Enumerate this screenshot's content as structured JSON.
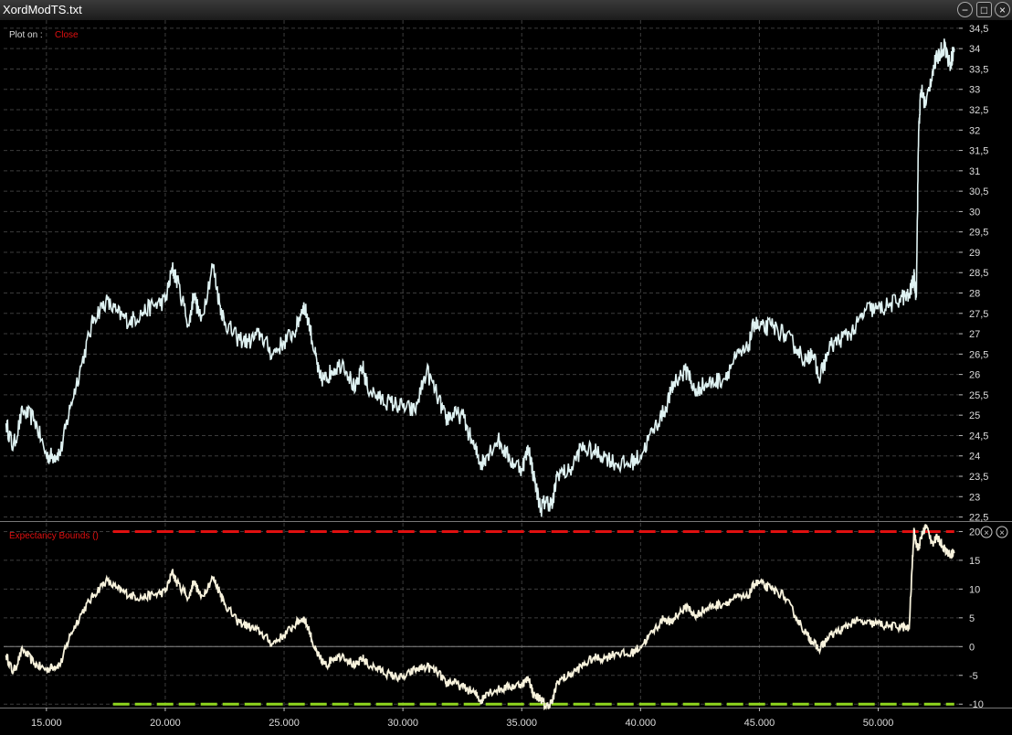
{
  "window": {
    "title": "XordModTS.txt",
    "min_icon": "minimize-icon",
    "max_icon": "maximize-icon",
    "close_icon": "close-icon"
  },
  "colors": {
    "background": "#000000",
    "grid": "#3c3c3c",
    "price_line": "#dff2f2",
    "bounds_line": "#f7f2dc",
    "upper_bound": "#e01010",
    "lower_bound": "#8fd61e",
    "label_red": "#e01010",
    "text": "#dddddd"
  },
  "chart_data": [
    {
      "type": "line",
      "plot_label": "Plot on : ",
      "series_label": "Close",
      "xlim": [
        13200,
        53400
      ],
      "ylim": [
        22.4,
        34.7
      ],
      "x_ticks": [
        15000,
        20000,
        25000,
        30000,
        35000,
        40000,
        45000,
        50000
      ],
      "x_tick_labels": [
        "15.000",
        "20.000",
        "25.000",
        "30.000",
        "35.000",
        "40.000",
        "45.000",
        "50.000"
      ],
      "y_ticks": [
        22.5,
        23,
        23.5,
        24,
        24.5,
        25,
        25.5,
        26,
        26.5,
        27,
        27.5,
        28,
        28.5,
        29,
        29.5,
        30,
        30.5,
        31,
        31.5,
        32,
        32.5,
        33,
        33.5,
        34,
        34.5
      ],
      "y_tick_labels": [
        "22,5",
        "23",
        "23,5",
        "24",
        "24,5",
        "25",
        "25,5",
        "26",
        "26,5",
        "27",
        "27,5",
        "28",
        "28,5",
        "29",
        "29,5",
        "30",
        "30,5",
        "31",
        "31,5",
        "32",
        "32,5",
        "33",
        "33,5",
        "34",
        "34,5"
      ],
      "grid": true,
      "x": [
        13300,
        13600,
        14000,
        14500,
        15000,
        15300,
        15600,
        16000,
        16500,
        17000,
        17500,
        18000,
        18500,
        19000,
        19500,
        20000,
        20300,
        20500,
        21000,
        21200,
        21500,
        22000,
        22300,
        22500,
        23000,
        23500,
        24000,
        24500,
        25000,
        25500,
        25800,
        26000,
        26300,
        26500,
        26800,
        27000,
        27500,
        28000,
        28300,
        28500,
        29000,
        29500,
        30000,
        30500,
        31000,
        31500,
        31800,
        32000,
        32500,
        33000,
        33300,
        33500,
        34000,
        34500,
        35000,
        35300,
        35500,
        35800,
        36000,
        36300,
        36500,
        37000,
        37500,
        38000,
        38500,
        39000,
        39500,
        40000,
        40500,
        41000,
        41300,
        41500,
        42000,
        42300,
        42500,
        43000,
        43500,
        44000,
        44500,
        44800,
        45000,
        45500,
        46000,
        46500,
        47000,
        47200,
        47500,
        48000,
        48500,
        49000,
        49500,
        50000,
        50500,
        51000,
        51300,
        51500,
        51600,
        51700,
        51800,
        52000,
        52300,
        52500,
        52800,
        53000,
        53200
      ],
      "values": [
        24.8,
        24.2,
        25.1,
        24.9,
        24.0,
        24.0,
        24.1,
        25.2,
        26.3,
        27.4,
        27.8,
        27.5,
        27.3,
        27.5,
        27.7,
        27.8,
        28.6,
        28.3,
        27.2,
        28.0,
        27.3,
        28.7,
        27.7,
        27.3,
        26.9,
        26.8,
        27.0,
        26.5,
        26.8,
        27.1,
        27.7,
        27.4,
        26.5,
        25.9,
        25.9,
        26.1,
        26.3,
        25.6,
        26.2,
        25.7,
        25.4,
        25.3,
        25.2,
        25.1,
        26.1,
        25.4,
        24.9,
        25.0,
        25.0,
        24.2,
        23.8,
        24.0,
        24.4,
        23.9,
        23.7,
        24.2,
        23.5,
        22.7,
        22.9,
        22.8,
        23.6,
        23.6,
        24.2,
        24.1,
        24.0,
        23.8,
        23.8,
        24.0,
        24.6,
        25.1,
        25.6,
        25.9,
        26.1,
        25.5,
        25.7,
        25.8,
        25.9,
        26.4,
        26.6,
        27.3,
        27.1,
        27.2,
        27.0,
        26.7,
        26.3,
        26.6,
        25.9,
        26.7,
        26.9,
        27.1,
        27.6,
        27.6,
        27.7,
        27.9,
        27.9,
        28.4,
        27.9,
        32.0,
        33.0,
        32.6,
        33.5,
        33.8,
        34.1,
        33.6,
        34.0
      ]
    },
    {
      "type": "line",
      "series_label": "Expectancy Bounds ()",
      "xlim": [
        13200,
        53400
      ],
      "ylim": [
        -10.6,
        21.5
      ],
      "y_ticks": [
        -10,
        -5,
        0,
        5,
        10,
        15,
        20
      ],
      "y_tick_labels": [
        "-10",
        "-5",
        "0",
        "5",
        "10",
        "15",
        "20"
      ],
      "upper_bound": {
        "value": 20,
        "x_start": 17800,
        "x_end": 53200
      },
      "lower_bound": {
        "value": -10,
        "x_start": 17800,
        "x_end": 53200
      },
      "zero_line": 0,
      "grid": true,
      "x": [
        13300,
        13600,
        14000,
        14500,
        15000,
        15300,
        15600,
        16000,
        16500,
        17000,
        17500,
        18000,
        18500,
        19000,
        19500,
        20000,
        20300,
        20500,
        21000,
        21200,
        21500,
        22000,
        22300,
        22500,
        23000,
        23500,
        24000,
        24500,
        25000,
        25500,
        25800,
        26000,
        26300,
        26500,
        26800,
        27000,
        27500,
        28000,
        28300,
        28500,
        29000,
        29500,
        30000,
        30500,
        31000,
        31500,
        31800,
        32000,
        32500,
        33000,
        33300,
        33500,
        34000,
        34500,
        35000,
        35300,
        35500,
        35800,
        36000,
        36300,
        36500,
        37000,
        37500,
        38000,
        38500,
        39000,
        39500,
        40000,
        40500,
        41000,
        41300,
        41500,
        42000,
        42300,
        42500,
        43000,
        43500,
        44000,
        44500,
        44800,
        45000,
        45500,
        46000,
        46500,
        47000,
        47200,
        47500,
        48000,
        48500,
        49000,
        49500,
        50000,
        50500,
        51000,
        51300,
        51500,
        51600,
        51700,
        51800,
        52000,
        52300,
        52500,
        52800,
        53000,
        53200
      ],
      "values": [
        -1.5,
        -4.5,
        -0.5,
        -3.0,
        -4.0,
        -3.5,
        -3.0,
        2.0,
        6.0,
        9.0,
        11.5,
        10.0,
        9.0,
        8.5,
        9.0,
        9.5,
        13.0,
        11.0,
        8.5,
        11.5,
        8.5,
        12.0,
        9.5,
        7.5,
        4.5,
        3.5,
        2.5,
        0.5,
        2.0,
        4.0,
        5.0,
        3.5,
        -0.5,
        -2.0,
        -3.5,
        -2.0,
        -1.5,
        -3.5,
        -2.0,
        -3.0,
        -4.0,
        -5.0,
        -5.5,
        -4.0,
        -3.5,
        -4.5,
        -6.5,
        -6.0,
        -7.0,
        -8.0,
        -9.5,
        -8.0,
        -7.5,
        -7.0,
        -6.5,
        -5.5,
        -8.5,
        -9.0,
        -10.5,
        -9.5,
        -6.0,
        -5.0,
        -3.5,
        -2.0,
        -2.0,
        -1.0,
        -1.5,
        0.0,
        2.5,
        5.0,
        4.0,
        5.5,
        7.0,
        5.0,
        6.0,
        7.0,
        7.5,
        8.5,
        8.5,
        11.0,
        11.0,
        10.0,
        9.0,
        5.5,
        2.0,
        1.0,
        -0.5,
        2.0,
        3.0,
        4.5,
        4.0,
        4.0,
        3.5,
        3.5,
        3.0,
        20.0,
        18.0,
        17.0,
        19.0,
        21.0,
        18.0,
        19.0,
        17.0,
        16.0,
        16.5
      ]
    }
  ]
}
